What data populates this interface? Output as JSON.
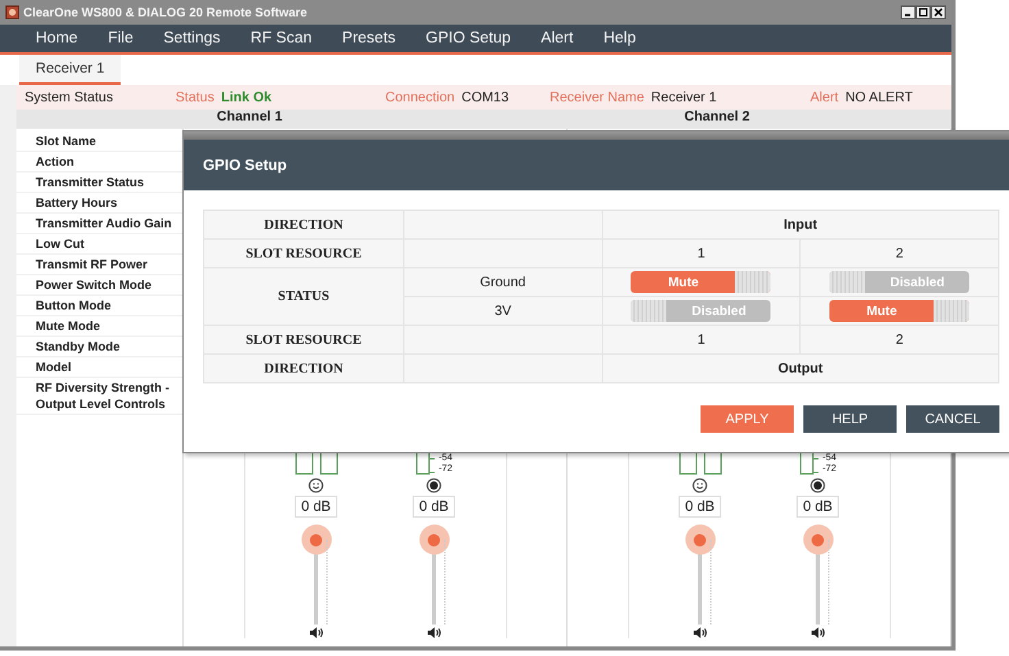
{
  "window": {
    "title": "ClearOne WS800 & DIALOG 20 Remote Software"
  },
  "menu": [
    "Home",
    "File",
    "Settings",
    "RF Scan",
    "Presets",
    "GPIO Setup",
    "Alert",
    "Help"
  ],
  "tabs": [
    {
      "label": "Receiver 1",
      "selected": true
    }
  ],
  "system_status": {
    "label": "System Status",
    "fields": [
      {
        "name": "Status",
        "value": "Link Ok",
        "kind": "ok"
      },
      {
        "name": "Connection",
        "value": "COM13",
        "kind": "text"
      },
      {
        "name": "Receiver Name",
        "value": "Receiver 1",
        "kind": "text"
      },
      {
        "name": "Alert",
        "value": "NO ALERT",
        "kind": "text"
      }
    ]
  },
  "channels": [
    "Channel 1",
    "Channel 2"
  ],
  "parameters": [
    "Slot Name",
    "Action",
    "Transmitter Status",
    "Battery Hours",
    "Transmitter Audio Gain",
    "Low Cut",
    "Transmit RF Power",
    "Power Switch Mode",
    "Button Mode",
    "Mute Mode",
    "Standby Mode",
    "Model",
    "RF Diversity Strength - Output Level Controls"
  ],
  "faders": [
    {
      "kind": "mic",
      "reading": "0 dB",
      "level": 1
    },
    {
      "kind": "jack",
      "reading": "0 dB",
      "level": 1,
      "meter_labels": [
        "-54",
        "-72"
      ]
    },
    {
      "kind": "mic",
      "reading": "0 dB",
      "level": 1
    },
    {
      "kind": "jack",
      "reading": "0 dB",
      "level": 1,
      "meter_labels": [
        "-54",
        "-72"
      ]
    }
  ],
  "gpio_dialog": {
    "title": "GPIO Setup",
    "rows": [
      {
        "kind": "span",
        "label": "DIRECTION",
        "value": "Input"
      },
      {
        "kind": "slots",
        "label": "SLOT RESOURCE",
        "values": [
          "1",
          "2"
        ]
      },
      {
        "kind": "status",
        "label": "STATUS",
        "lines": [
          {
            "name": "Ground",
            "toggles": [
              {
                "label": "Mute",
                "on": true
              },
              {
                "label": "Disabled",
                "on": false
              }
            ]
          },
          {
            "name": "3V",
            "toggles": [
              {
                "label": "Disabled",
                "on": false
              },
              {
                "label": "Mute",
                "on": true
              }
            ]
          }
        ]
      },
      {
        "kind": "slots",
        "label": "SLOT RESOURCE",
        "values": [
          "1",
          "2"
        ]
      },
      {
        "kind": "span",
        "label": "DIRECTION",
        "value": "Output"
      }
    ],
    "buttons": [
      {
        "label": "APPLY",
        "kind": "primary"
      },
      {
        "label": "HELP",
        "kind": "secondary"
      },
      {
        "label": "CANCEL",
        "kind": "secondary"
      }
    ]
  }
}
